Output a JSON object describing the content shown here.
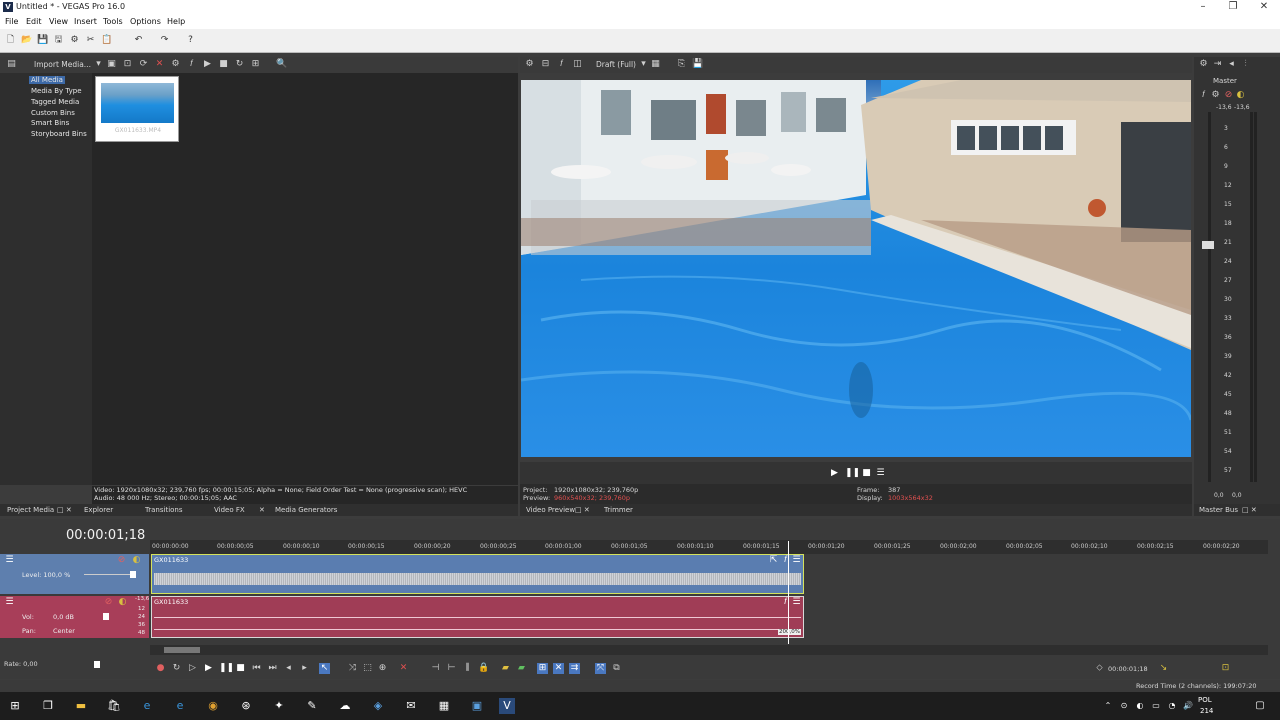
{
  "window": {
    "title": "Untitled * - VEGAS Pro 16.0"
  },
  "menu": [
    "File",
    "Edit",
    "View",
    "Insert",
    "Tools",
    "Options",
    "Help"
  ],
  "project_media": {
    "import_label": "Import Media...",
    "tree": [
      "All Media",
      "Media By Type",
      "Tagged Media",
      "Custom Bins",
      "Smart Bins",
      "Storyboard Bins"
    ],
    "thumbnail_label": "GX011633.MP4",
    "info_line1": "Video: 1920x1080x32; 239,760 fps; 00:00:15;05; Alpha = None; Field Order Test = None (progressive scan); HEVC",
    "info_line2": "Audio: 48 000 Hz; Stereo; 00:00:15;05; AAC"
  },
  "left_tabs": [
    "Project Media",
    "Explorer",
    "Transitions",
    "Video FX",
    "Media Generators"
  ],
  "preview": {
    "quality": "Draft (Full)",
    "project_label": "Project:",
    "project_value": "1920x1080x32; 239,760p",
    "preview_label": "Preview:",
    "preview_value": "960x540x32; 239,760p",
    "frame_label": "Frame:",
    "frame_value": "387",
    "display_label": "Display:",
    "display_value": "1003x564x32",
    "tabs": [
      "Video Preview",
      "Trimmer"
    ]
  },
  "master_bus": {
    "title": "Master",
    "peak_left": "-13,6",
    "peak_right": "-13,6",
    "scale": [
      "3",
      "6",
      "9",
      "12",
      "15",
      "18",
      "21",
      "24",
      "27",
      "30",
      "33",
      "36",
      "39",
      "42",
      "45",
      "48",
      "51",
      "54",
      "57"
    ],
    "bottom_left": "0,0",
    "bottom_right": "0,0",
    "tab": "Master Bus"
  },
  "timeline": {
    "timecode": "00:00:01;18",
    "ruler": [
      "00:00:00:00",
      "00:00:00;05",
      "00:00:00;10",
      "00:00:00;15",
      "00:00:00;20",
      "00:00:00;25",
      "00:00:01;00",
      "00:00:01;05",
      "00:00:01;10",
      "00:00:01;15",
      "00:00:01;20",
      "00:00:01;25",
      "00:00:02;00",
      "00:00:02;05",
      "00:00:02;10",
      "00:00:02;15",
      "00:00:02;20"
    ],
    "video_track": {
      "level_label": "Level: 100,0 %",
      "clip_name": "GX011633"
    },
    "audio_track": {
      "vol_label": "Vol:",
      "vol_value": "0,0 dB",
      "pan_label": "Pan:",
      "pan_value": "Center",
      "clip_name": "GX011633",
      "speed_badge": "200,0%",
      "meter": [
        "-13,6",
        "12",
        "24",
        "36",
        "48"
      ]
    },
    "rate": "Rate: 0,00",
    "cursor_time": "00:00:01;18"
  },
  "status": {
    "record_time": "Record Time (2 channels): 199:07:20"
  },
  "taskbar": {
    "lang": "POL",
    "lang2": "214"
  }
}
